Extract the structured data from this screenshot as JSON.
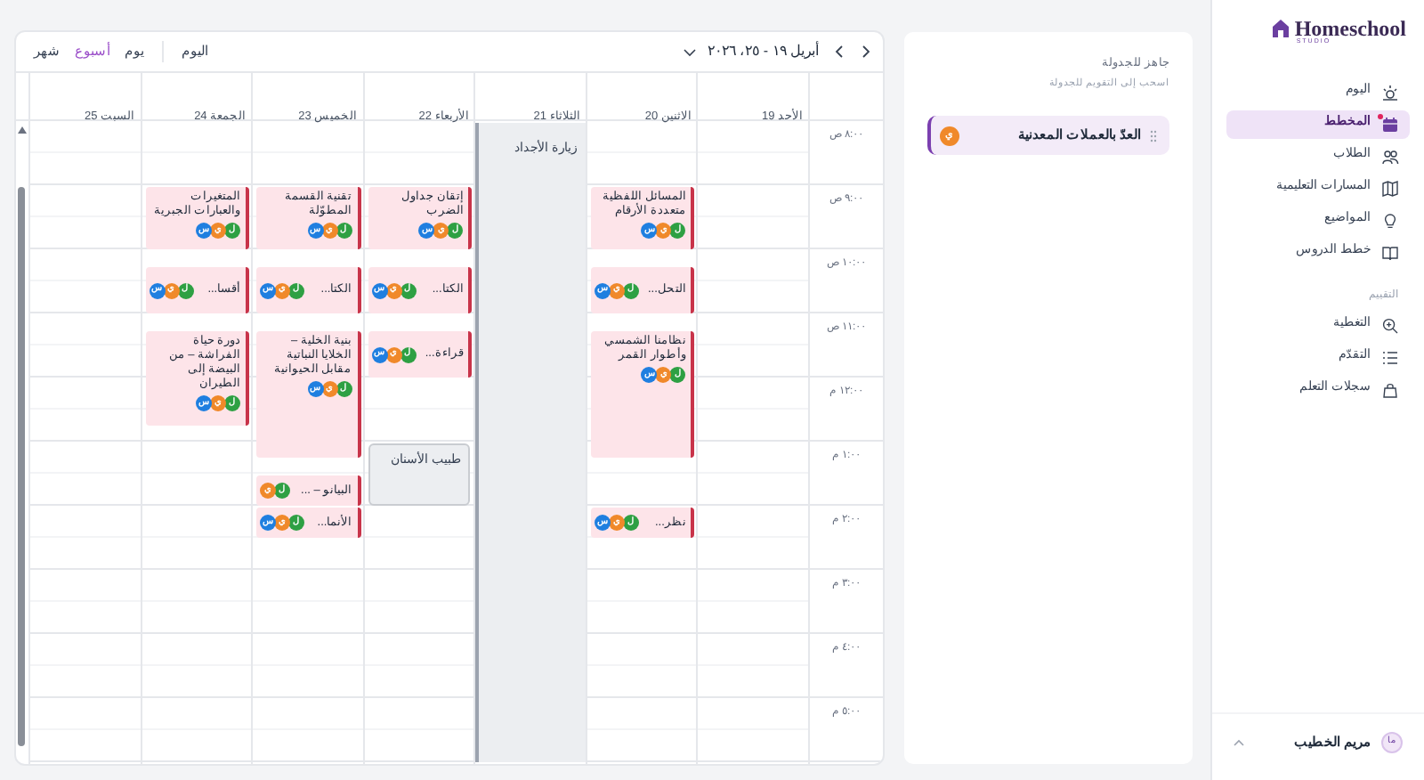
{
  "sidebar": {
    "logo": {
      "name": "Homeschool",
      "tagline": "STUDIO"
    },
    "nav": [
      {
        "label": "اليوم",
        "selected": false,
        "alert": false
      },
      {
        "label": "المخطط",
        "selected": true,
        "alert": true
      },
      {
        "label": "الطلاب",
        "selected": false,
        "alert": false
      },
      {
        "label": "المسارات التعليمية",
        "selected": false,
        "alert": false
      },
      {
        "label": "المواضيع",
        "selected": false,
        "alert": false
      },
      {
        "label": "خطط الدروس",
        "selected": false,
        "alert": false
      }
    ],
    "section_label": "التقييم",
    "section_items": [
      {
        "label": "التغطية",
        "selected": false,
        "alert": false
      },
      {
        "label": "التقدّم",
        "selected": false,
        "alert": false
      },
      {
        "label": "سجلات التعلم",
        "selected": false,
        "alert": false
      }
    ],
    "user": {
      "initials": "ما",
      "name": "مريم الخطيب"
    }
  },
  "backlog": {
    "title": "جاهز للجدولة",
    "subtitle": "اسحب إلى التقويم للجدولة",
    "items": [
      {
        "title": "العدّ بالعملات المعدنية",
        "avatars": [
          {
            "letter": "ي",
            "color": "#f0892a"
          }
        ]
      }
    ]
  },
  "calendar": {
    "range": "أبريل ١٩ - ٢٥، ٢٠٢٦",
    "today_button": "اليوم",
    "views": [
      {
        "label": "يوم",
        "selected": false
      },
      {
        "label": "أسبوع",
        "selected": true
      },
      {
        "label": "شهر",
        "selected": false
      }
    ],
    "hours": [
      "٨:٠٠ ص",
      "٩:٠٠ ص",
      "١٠:٠٠ ص",
      "١١:٠٠ ص",
      "١٢:٠٠ م",
      "١:٠٠ م",
      "٢:٠٠ م",
      "٣:٠٠ م",
      "٤:٠٠ م",
      "٥:٠٠ م"
    ],
    "days": [
      {
        "label": "الأحد 19"
      },
      {
        "label": "الاثنين 20",
        "events": [
          {
            "kind": "lesson",
            "title": "المسائل اللفظية متعددة الأرقام",
            "avatars": [
              {
                "letter": "ل",
                "color": "#2ea043"
              },
              {
                "letter": "ي",
                "color": "#f0892a"
              },
              {
                "letter": "س",
                "color": "#1f7fe0"
              }
            ]
          },
          {
            "kind": "lesson",
            "title": "التحل...",
            "avatars": [
              {
                "letter": "ل",
                "color": "#2ea043"
              },
              {
                "letter": "ي",
                "color": "#f0892a"
              },
              {
                "letter": "س",
                "color": "#1f7fe0"
              }
            ]
          },
          {
            "kind": "lesson",
            "title": "نظامنا الشمسي وأطوار القمر",
            "avatars": [
              {
                "letter": "ل",
                "color": "#2ea043"
              },
              {
                "letter": "ي",
                "color": "#f0892a"
              },
              {
                "letter": "س",
                "color": "#1f7fe0"
              }
            ]
          },
          {
            "kind": "lesson",
            "title": "نظر...",
            "avatars": [
              {
                "letter": "ل",
                "color": "#2ea043"
              },
              {
                "letter": "ي",
                "color": "#f0892a"
              },
              {
                "letter": "س",
                "color": "#1f7fe0"
              }
            ]
          }
        ]
      },
      {
        "label": "الثلاثاء 21",
        "events": [
          {
            "kind": "block",
            "title": "زيارة الأجداد"
          }
        ]
      },
      {
        "label": "الأربعاء 22",
        "events": [
          {
            "kind": "lesson",
            "title": "إتقان جداول الضرب",
            "avatars": [
              {
                "letter": "ل",
                "color": "#2ea043"
              },
              {
                "letter": "ي",
                "color": "#f0892a"
              },
              {
                "letter": "س",
                "color": "#1f7fe0"
              }
            ]
          },
          {
            "kind": "lesson",
            "title": "الكتا...",
            "avatars": [
              {
                "letter": "ل",
                "color": "#2ea043"
              },
              {
                "letter": "ي",
                "color": "#f0892a"
              },
              {
                "letter": "س",
                "color": "#1f7fe0"
              }
            ]
          },
          {
            "kind": "lesson",
            "title": "قراءة...",
            "avatars": [
              {
                "letter": "ل",
                "color": "#2ea043"
              },
              {
                "letter": "ي",
                "color": "#f0892a"
              },
              {
                "letter": "س",
                "color": "#1f7fe0"
              }
            ]
          },
          {
            "kind": "appointment",
            "title": "طبيب الأسنان"
          }
        ]
      },
      {
        "label": "الخميس 23",
        "events": [
          {
            "kind": "lesson",
            "title": "تقنية القسمة المطوّلة",
            "avatars": [
              {
                "letter": "ل",
                "color": "#2ea043"
              },
              {
                "letter": "ي",
                "color": "#f0892a"
              },
              {
                "letter": "س",
                "color": "#1f7fe0"
              }
            ]
          },
          {
            "kind": "lesson",
            "title": "الكتا...",
            "avatars": [
              {
                "letter": "ل",
                "color": "#2ea043"
              },
              {
                "letter": "ي",
                "color": "#f0892a"
              },
              {
                "letter": "س",
                "color": "#1f7fe0"
              }
            ]
          },
          {
            "kind": "lesson",
            "title": "بنية الخلية – الخلايا النباتية مقابل الحيوانية",
            "avatars": [
              {
                "letter": "ل",
                "color": "#2ea043"
              },
              {
                "letter": "ي",
                "color": "#f0892a"
              },
              {
                "letter": "س",
                "color": "#1f7fe0"
              }
            ]
          },
          {
            "kind": "lesson",
            "title": "البيانو – ...",
            "avatars": [
              {
                "letter": "ل",
                "color": "#2ea043"
              },
              {
                "letter": "ي",
                "color": "#f0892a"
              }
            ]
          },
          {
            "kind": "lesson",
            "title": "الأنما...",
            "avatars": [
              {
                "letter": "ل",
                "color": "#2ea043"
              },
              {
                "letter": "ي",
                "color": "#f0892a"
              },
              {
                "letter": "س",
                "color": "#1f7fe0"
              }
            ]
          }
        ]
      },
      {
        "label": "الجمعة 24",
        "events": [
          {
            "kind": "lesson",
            "title": "المتغيرات والعبارات الجبرية",
            "avatars": [
              {
                "letter": "ل",
                "color": "#2ea043"
              },
              {
                "letter": "ي",
                "color": "#f0892a"
              },
              {
                "letter": "س",
                "color": "#1f7fe0"
              }
            ]
          },
          {
            "kind": "lesson",
            "title": "أقسا...",
            "avatars": [
              {
                "letter": "ل",
                "color": "#2ea043"
              },
              {
                "letter": "ي",
                "color": "#f0892a"
              },
              {
                "letter": "س",
                "color": "#1f7fe0"
              }
            ]
          },
          {
            "kind": "lesson",
            "title": "دورة حياة الفراشة – من البيضة إلى الطيران",
            "avatars": [
              {
                "letter": "ل",
                "color": "#2ea043"
              },
              {
                "letter": "ي",
                "color": "#f0892a"
              },
              {
                "letter": "س",
                "color": "#1f7fe0"
              }
            ]
          }
        ]
      },
      {
        "label": "السبت 25"
      }
    ]
  }
}
